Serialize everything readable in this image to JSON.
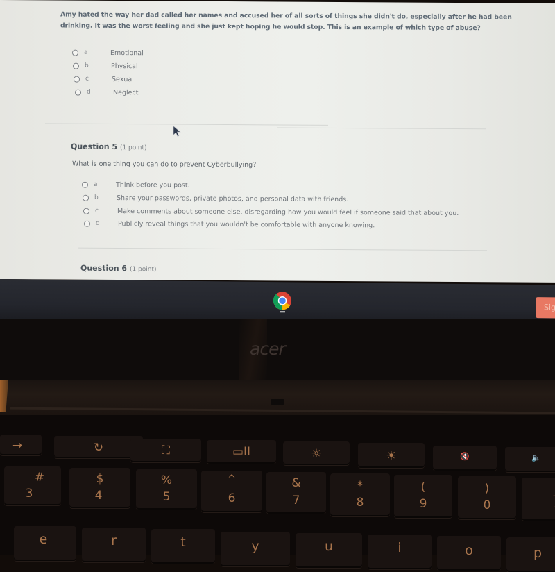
{
  "quiz": {
    "question4": {
      "text": "Amy hated the way her dad called her names and accused her of all sorts of things she didn't do, especially after he had been drinking. It was the worst feeling and she just kept hoping he would stop.  This is an example of which type of abuse?",
      "options": [
        {
          "letter": "a",
          "text": "Emotional",
          "selected": false
        },
        {
          "letter": "b",
          "text": "Physical",
          "selected": false
        },
        {
          "letter": "c",
          "text": "Sexual",
          "selected": false
        },
        {
          "letter": "d",
          "text": "Neglect",
          "selected": false
        }
      ]
    },
    "question5": {
      "title": "Question 5",
      "points": "(1 point)",
      "prompt": "What is one thing you can do to prevent Cyberbullying?",
      "options": [
        {
          "letter": "a",
          "text": "Think before you post.",
          "selected": false
        },
        {
          "letter": "b",
          "text": "Share your passwords, private photos, and personal data with friends.",
          "selected": false
        },
        {
          "letter": "c",
          "text": "Make comments about someone else, disregarding how you would feel if someone said that about you.",
          "selected": false
        },
        {
          "letter": "d",
          "text": "Publicly reveal things that you wouldn't be comfortable with anyone knowing.",
          "selected": false
        }
      ]
    },
    "question6": {
      "title": "Question 6",
      "points": "(1 point)"
    }
  },
  "shelf": {
    "apps": [
      {
        "name": "Google Chrome",
        "icon": "chrome-icon",
        "active": true
      }
    ],
    "sign_button_label": "Sig",
    "sign_button_color": "#e87863"
  },
  "laptop": {
    "brand": "acer",
    "function_keys": [
      "→",
      "↻",
      "⛶",
      "▭II",
      "☼",
      "☀",
      "🔇",
      "🔈"
    ],
    "number_row": [
      {
        "shift": "#",
        "main": "3"
      },
      {
        "shift": "$",
        "main": "4"
      },
      {
        "shift": "%",
        "main": "5"
      },
      {
        "shift": "^",
        "main": "6"
      },
      {
        "shift": "&",
        "main": "7"
      },
      {
        "shift": "*",
        "main": "8"
      },
      {
        "shift": "(",
        "main": "9"
      },
      {
        "shift": ")",
        "main": "0"
      },
      {
        "shift": "_",
        "main": "-"
      }
    ],
    "letter_row": [
      "e",
      "r",
      "t",
      "y",
      "u",
      "i",
      "o",
      "p"
    ]
  }
}
